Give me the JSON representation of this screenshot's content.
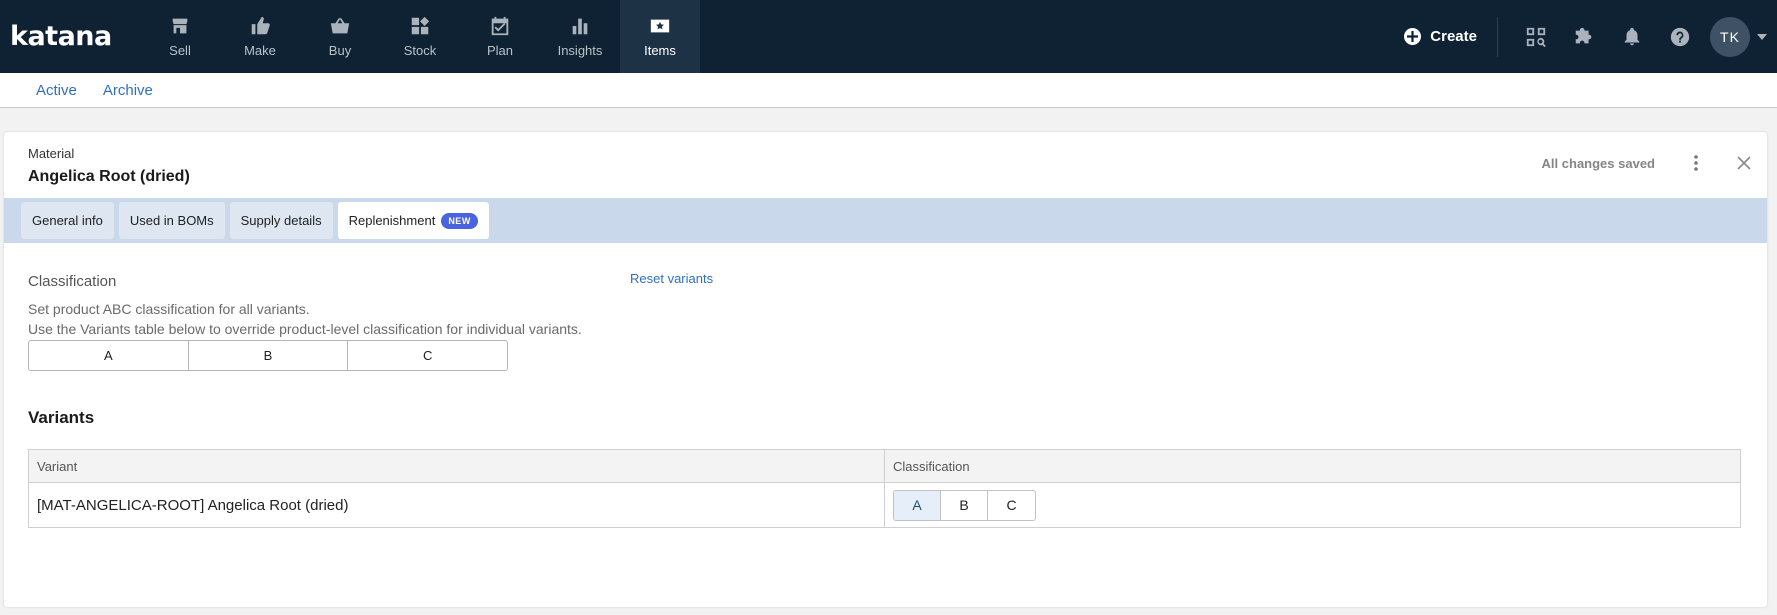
{
  "brand": {
    "logo_text": "katana"
  },
  "nav": [
    {
      "label": "Sell",
      "icon": "store-icon"
    },
    {
      "label": "Make",
      "icon": "thumbs-up-icon"
    },
    {
      "label": "Buy",
      "icon": "basket-icon"
    },
    {
      "label": "Stock",
      "icon": "boxes-icon"
    },
    {
      "label": "Plan",
      "icon": "calendar-check-icon"
    },
    {
      "label": "Insights",
      "icon": "bar-chart-icon"
    },
    {
      "label": "Items",
      "icon": "tag-star-icon",
      "active": true
    }
  ],
  "topbar": {
    "create_label": "Create",
    "avatar_initials": "TK",
    "icons": [
      "search-grid-icon",
      "puzzle-icon",
      "bell-icon",
      "help-icon"
    ]
  },
  "subnav": {
    "active_label": "Active",
    "archive_label": "Archive"
  },
  "item": {
    "kind": "Material",
    "name": "Angelica Root (dried)",
    "status": "All changes saved"
  },
  "tabs": [
    {
      "label": "General info"
    },
    {
      "label": "Used in BOMs"
    },
    {
      "label": "Supply details"
    },
    {
      "label": "Replenishment",
      "badge": "NEW",
      "active": true
    }
  ],
  "classification": {
    "title": "Classification",
    "desc1": "Set product ABC classification for all variants.",
    "desc2": "Use the Variants table below to override product-level classification for individual variants.",
    "reset_label": "Reset variants",
    "options": [
      "A",
      "B",
      "C"
    ]
  },
  "variants": {
    "title": "Variants",
    "columns": [
      "Variant",
      "Classification"
    ],
    "rows": [
      {
        "variant": "[MAT-ANGELICA-ROOT] Angelica Root (dried)",
        "selected": "A",
        "options": [
          "A",
          "B",
          "C"
        ]
      }
    ]
  },
  "colors": {
    "topbar_bg": "#0f2233",
    "tabs_bar_bg": "#c9d8ea",
    "link": "#2f6fc3",
    "badge": "#4a63e0"
  }
}
